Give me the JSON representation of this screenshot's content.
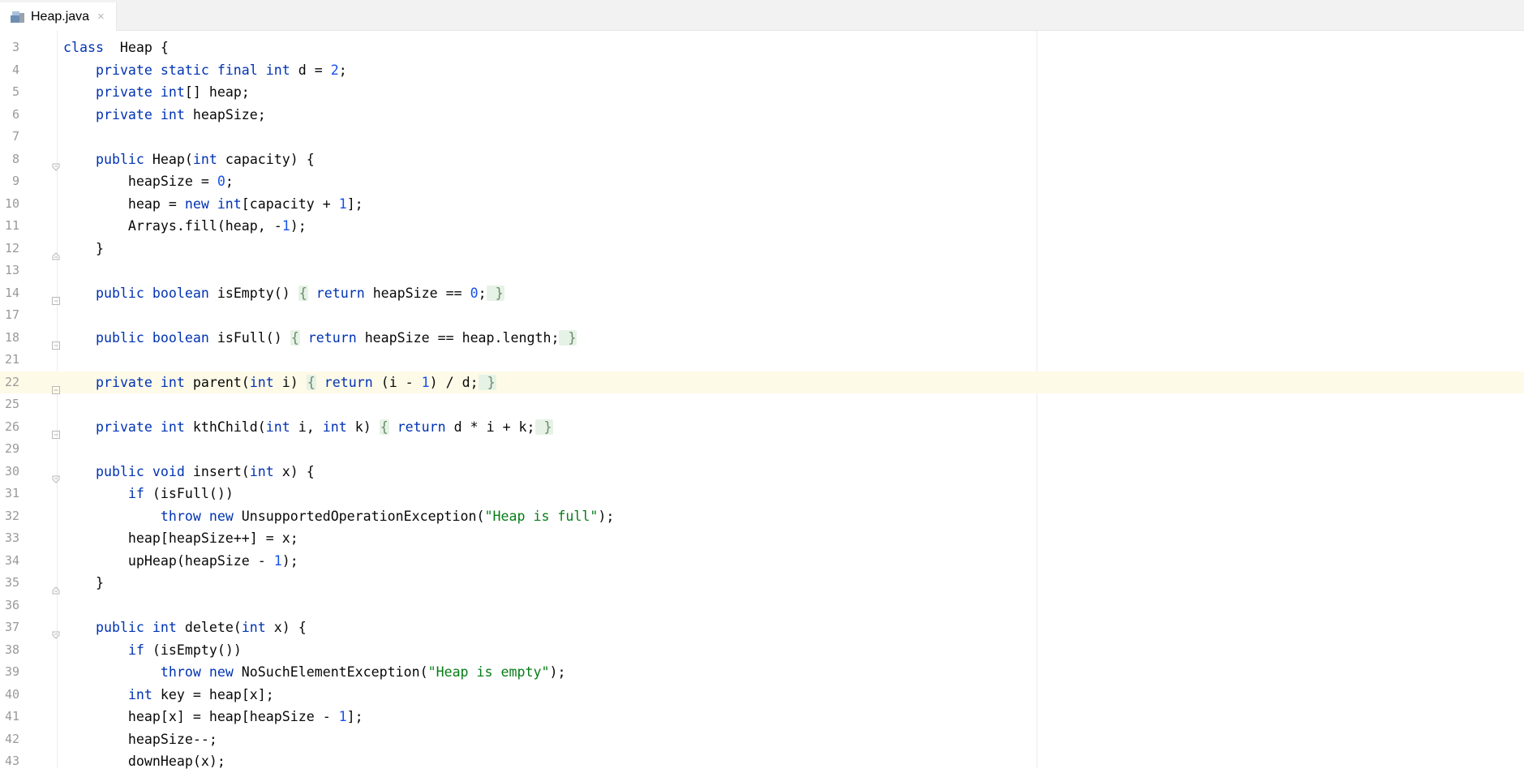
{
  "tab": {
    "icon": "java-class-file-icon",
    "label": "Heap.java",
    "close": "×"
  },
  "editor": {
    "current_line": 22,
    "lines": [
      {
        "n": "3",
        "code": [
          [
            "kw",
            "class"
          ],
          [
            "",
            "  Heap {"
          ]
        ],
        "fold": ""
      },
      {
        "n": "4",
        "code": [
          [
            "",
            "    "
          ],
          [
            "kw",
            "private static final int"
          ],
          [
            "",
            " d = "
          ],
          [
            "num",
            "2"
          ],
          [
            "",
            ";"
          ]
        ],
        "fold": ""
      },
      {
        "n": "5",
        "code": [
          [
            "",
            "    "
          ],
          [
            "kw",
            "private int"
          ],
          [
            "",
            "[] heap;"
          ]
        ],
        "fold": ""
      },
      {
        "n": "6",
        "code": [
          [
            "",
            "    "
          ],
          [
            "kw",
            "private int"
          ],
          [
            "",
            " heapSize;"
          ]
        ],
        "fold": ""
      },
      {
        "n": "7",
        "code": [],
        "fold": ""
      },
      {
        "n": "8",
        "code": [
          [
            "",
            "    "
          ],
          [
            "kw",
            "public"
          ],
          [
            "",
            " Heap("
          ],
          [
            "kw",
            "int"
          ],
          [
            "",
            " capacity) {"
          ]
        ],
        "fold": "open"
      },
      {
        "n": "9",
        "code": [
          [
            "",
            "        heapSize = "
          ],
          [
            "num",
            "0"
          ],
          [
            "",
            ";"
          ]
        ],
        "fold": ""
      },
      {
        "n": "10",
        "code": [
          [
            "",
            "        heap = "
          ],
          [
            "kw",
            "new int"
          ],
          [
            "",
            "[capacity + "
          ],
          [
            "num",
            "1"
          ],
          [
            "",
            "];"
          ]
        ],
        "fold": ""
      },
      {
        "n": "11",
        "code": [
          [
            "",
            "        Arrays.fill(heap, -"
          ],
          [
            "num",
            "1"
          ],
          [
            "",
            ");"
          ]
        ],
        "fold": ""
      },
      {
        "n": "12",
        "code": [
          [
            "",
            "    }"
          ]
        ],
        "fold": "close"
      },
      {
        "n": "13",
        "code": [],
        "fold": ""
      },
      {
        "n": "14",
        "code": [
          [
            "",
            "    "
          ],
          [
            "kw",
            "public boolean"
          ],
          [
            "",
            " isEmpty() "
          ],
          [
            "fb",
            "{"
          ],
          [
            "",
            " "
          ],
          [
            "kw",
            "return"
          ],
          [
            "",
            " heapSize == "
          ],
          [
            "num",
            "0"
          ],
          [
            "",
            ";"
          ],
          [
            "fb",
            " }"
          ]
        ],
        "fold": "folded"
      },
      {
        "n": "17",
        "code": [],
        "fold": ""
      },
      {
        "n": "18",
        "code": [
          [
            "",
            "    "
          ],
          [
            "kw",
            "public boolean"
          ],
          [
            "",
            " isFull() "
          ],
          [
            "fb",
            "{"
          ],
          [
            "",
            " "
          ],
          [
            "kw",
            "return"
          ],
          [
            "",
            " heapSize == heap.length;"
          ],
          [
            "fb",
            " }"
          ]
        ],
        "fold": "folded"
      },
      {
        "n": "21",
        "code": [],
        "fold": ""
      },
      {
        "n": "22",
        "code": [
          [
            "",
            "    "
          ],
          [
            "kw",
            "private int"
          ],
          [
            "",
            " parent("
          ],
          [
            "kw",
            "int"
          ],
          [
            "",
            " i) "
          ],
          [
            "fb",
            "{"
          ],
          [
            "",
            " "
          ],
          [
            "kw",
            "return"
          ],
          [
            "",
            " (i - "
          ],
          [
            "num",
            "1"
          ],
          [
            "",
            ") / d;"
          ],
          [
            "fb",
            " }"
          ]
        ],
        "fold": "folded"
      },
      {
        "n": "25",
        "code": [],
        "fold": ""
      },
      {
        "n": "26",
        "code": [
          [
            "",
            "    "
          ],
          [
            "kw",
            "private int"
          ],
          [
            "",
            " kthChild("
          ],
          [
            "kw",
            "int"
          ],
          [
            "",
            " i, "
          ],
          [
            "kw",
            "int"
          ],
          [
            "",
            " k) "
          ],
          [
            "fb",
            "{"
          ],
          [
            "",
            " "
          ],
          [
            "kw",
            "return"
          ],
          [
            "",
            " d * i + k;"
          ],
          [
            "fb",
            " }"
          ]
        ],
        "fold": "folded"
      },
      {
        "n": "29",
        "code": [],
        "fold": ""
      },
      {
        "n": "30",
        "code": [
          [
            "",
            "    "
          ],
          [
            "kw",
            "public void"
          ],
          [
            "",
            " insert("
          ],
          [
            "kw",
            "int"
          ],
          [
            "",
            " x) {"
          ]
        ],
        "fold": "open"
      },
      {
        "n": "31",
        "code": [
          [
            "",
            "        "
          ],
          [
            "kw",
            "if"
          ],
          [
            "",
            " (isFull())"
          ]
        ],
        "fold": ""
      },
      {
        "n": "32",
        "code": [
          [
            "",
            "            "
          ],
          [
            "kw",
            "throw new"
          ],
          [
            "",
            " UnsupportedOperationException("
          ],
          [
            "str",
            "\"Heap is full\""
          ],
          [
            "",
            ");"
          ]
        ],
        "fold": ""
      },
      {
        "n": "33",
        "code": [
          [
            "",
            "        heap[heapSize++] = x;"
          ]
        ],
        "fold": ""
      },
      {
        "n": "34",
        "code": [
          [
            "",
            "        upHeap(heapSize - "
          ],
          [
            "num",
            "1"
          ],
          [
            "",
            ");"
          ]
        ],
        "fold": ""
      },
      {
        "n": "35",
        "code": [
          [
            "",
            "    }"
          ]
        ],
        "fold": "close"
      },
      {
        "n": "36",
        "code": [],
        "fold": ""
      },
      {
        "n": "37",
        "code": [
          [
            "",
            "    "
          ],
          [
            "kw",
            "public int"
          ],
          [
            "",
            " delete("
          ],
          [
            "kw",
            "int"
          ],
          [
            "",
            " x) {"
          ]
        ],
        "fold": "open"
      },
      {
        "n": "38",
        "code": [
          [
            "",
            "        "
          ],
          [
            "kw",
            "if"
          ],
          [
            "",
            " (isEmpty())"
          ]
        ],
        "fold": ""
      },
      {
        "n": "39",
        "code": [
          [
            "",
            "            "
          ],
          [
            "kw",
            "throw new"
          ],
          [
            "",
            " NoSuchElementException("
          ],
          [
            "str",
            "\"Heap is empty\""
          ],
          [
            "",
            ");"
          ]
        ],
        "fold": ""
      },
      {
        "n": "40",
        "code": [
          [
            "",
            "        "
          ],
          [
            "kw",
            "int"
          ],
          [
            "",
            " key = heap[x];"
          ]
        ],
        "fold": ""
      },
      {
        "n": "41",
        "code": [
          [
            "",
            "        heap[x] = heap[heapSize - "
          ],
          [
            "num",
            "1"
          ],
          [
            "",
            "];"
          ]
        ],
        "fold": ""
      },
      {
        "n": "42",
        "code": [
          [
            "",
            "        heapSize--;"
          ]
        ],
        "fold": ""
      },
      {
        "n": "43",
        "code": [
          [
            "",
            "        downHeap(x);"
          ]
        ],
        "fold": ""
      }
    ]
  },
  "colors": {
    "keyword": "#0033b3",
    "number": "#1750eb",
    "string": "#067d17",
    "current_line_bg": "#fefae8",
    "fold_highlight_bg": "#e6f2e6"
  }
}
